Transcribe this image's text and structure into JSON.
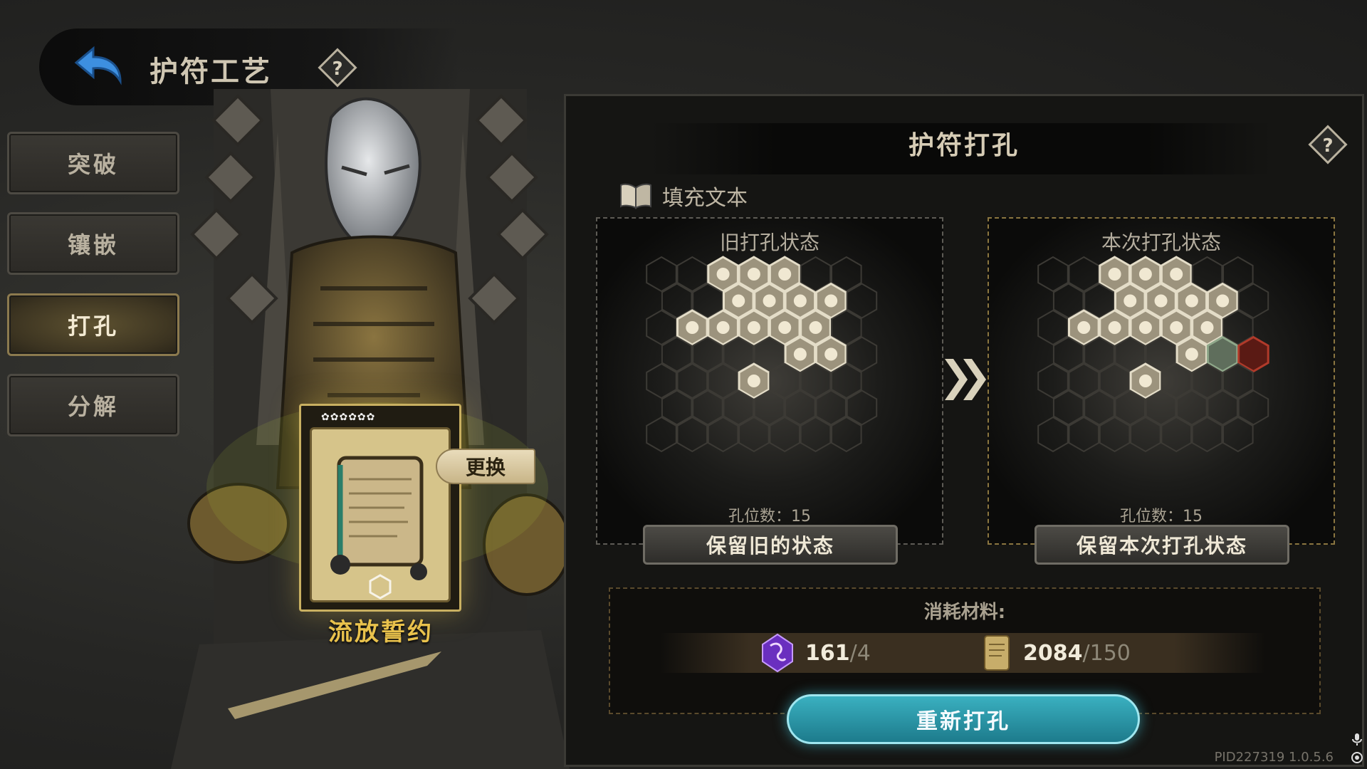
{
  "header": {
    "title": "护符工艺",
    "back_icon": "back-arrow-icon",
    "help_icon": "help-question-icon"
  },
  "tabs": [
    {
      "label": "突破",
      "active": false
    },
    {
      "label": "镶嵌",
      "active": false
    },
    {
      "label": "打孔",
      "active": true
    },
    {
      "label": "分解",
      "active": false
    }
  ],
  "card": {
    "stars": "✿✿✿✿✿✿",
    "name": "流放誓约",
    "swap_label": "更换"
  },
  "panel": {
    "title": "护符打孔",
    "filler_text": "填充文本",
    "old_state": {
      "title": "旧打孔状态",
      "count": "孔位数：15",
      "button": "保留旧的状态"
    },
    "new_state": {
      "title": "本次打孔状态",
      "count": "孔位数：15",
      "button": "保留本次打孔状态"
    },
    "materials": {
      "label": "消耗材料:",
      "items": [
        {
          "icon": "purple-rune-crystal-icon",
          "have": "161",
          "need": "/4"
        },
        {
          "icon": "parchment-scroll-icon",
          "have": "2084",
          "need": "/150"
        }
      ]
    },
    "redo_button": "重新打孔"
  },
  "version": "PID227319  1.0.5.6",
  "colors": {
    "accent_gold": "#c9b061",
    "button_cyan": "#2a98aa",
    "slot_red": "#8a2a1c"
  }
}
